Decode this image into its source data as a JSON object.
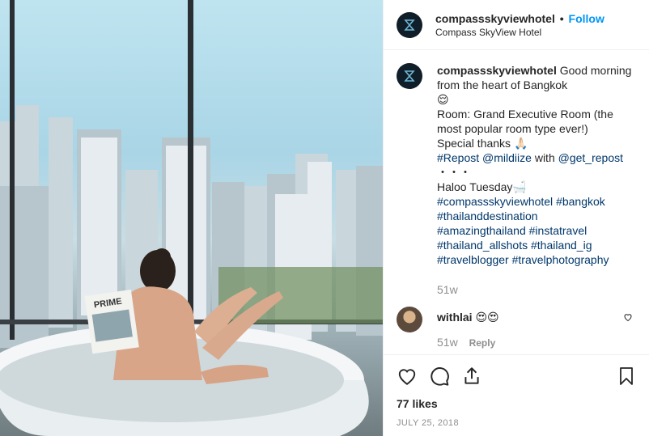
{
  "post": {
    "username": "compassskyviewhotel",
    "separator": "•",
    "follow_label": "Follow",
    "location": "Compass SkyView Hotel",
    "caption": {
      "username": "compassskyviewhotel",
      "line1": " Good morning from the heart of Bangkok",
      "emoji1": "😌",
      "line2": "Room: Grand Executive Room (the most popular room type ever!)",
      "line3": "Special thanks 🙏🏻",
      "repost_tag": "#Repost",
      "repost_user": "@mildiize",
      "with_text": " with ",
      "get_repost": "@get_repost",
      "dots": "・・・",
      "line4": "Haloo Tuesday🛁",
      "tags1": [
        "#compassskyviewhotel",
        "#bangkok"
      ],
      "tags2": [
        "#thailanddestination"
      ],
      "tags3": [
        "#amazingthailand",
        "#instatravel"
      ],
      "tags4": [
        "#thailand_allshots",
        "#thailand_ig"
      ],
      "tags5": [
        "#travelblogger",
        "#travelphotography"
      ],
      "age": "51w"
    },
    "comment": {
      "username": "withlai",
      "text": "😍😍",
      "age": "51w",
      "reply_label": "Reply"
    },
    "likes": "77 likes",
    "date": "JULY 25, 2018",
    "icons": [
      "heart-icon",
      "comment-icon",
      "share-icon",
      "bookmark-icon"
    ],
    "colors": {
      "link": "#00376b",
      "follow": "#0095f6",
      "muted": "#8e8e8e"
    },
    "photo": {
      "magazine_title": "PRIME"
    }
  }
}
